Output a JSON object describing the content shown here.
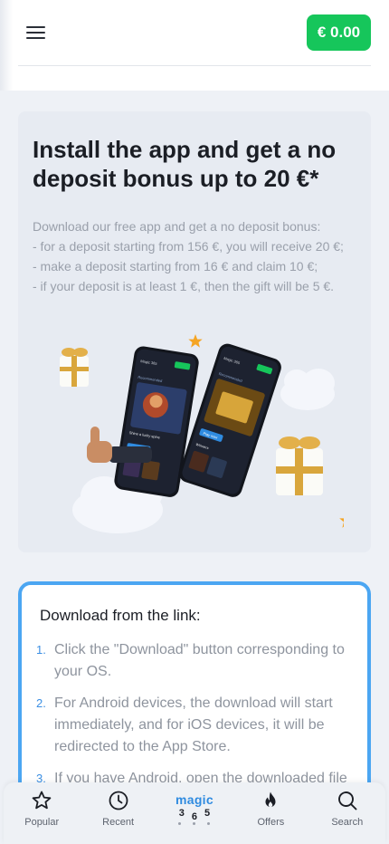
{
  "header": {
    "balance": "€ 0.00"
  },
  "promo": {
    "title": "Install the app and get a no deposit bonus up to 20 €*",
    "description": [
      "Download our free app and get a no deposit bonus:",
      "- for a deposit starting from 156 €, you will receive 20 €;",
      "- make a deposit starting from 16 € and claim 10 €;",
      "- if your deposit is at least 1 €, then the gift will be 5 €."
    ],
    "phone_left": {
      "brand": "Magic 365",
      "section": "Recommended",
      "card_title": "Shine a lucky spine",
      "button": "Play now"
    },
    "phone_right": {
      "brand": "Magic 365",
      "section": "Recommended",
      "button": "Play now",
      "section2": "Winners"
    }
  },
  "instructions": {
    "title": "Download from the link:",
    "steps": [
      {
        "num": "1.",
        "text": "Click the \"Download\" button corresponding to your OS."
      },
      {
        "num": "2.",
        "text": "For Android devices, the download will start immediately, and for iOS devices, it will be redirected to the App Store."
      },
      {
        "num": "3.",
        "text": "If you have Android, open the downloaded file and follow the instructions."
      }
    ]
  },
  "bottom_nav": {
    "items": [
      {
        "label": "Popular",
        "icon": "star-icon"
      },
      {
        "label": "Recent",
        "icon": "clock-icon"
      },
      {
        "label": "",
        "icon": "magic365-logo"
      },
      {
        "label": "Offers",
        "icon": "fire-icon"
      },
      {
        "label": "Search",
        "icon": "search-icon"
      }
    ],
    "logo": {
      "word": "magic",
      "digits": [
        "3",
        "6",
        "5"
      ]
    }
  },
  "colors": {
    "accent_green": "#16c65b",
    "accent_blue": "#4ba6f2",
    "card_bg": "#e7ebf2",
    "text_muted": "#9aa0ab"
  }
}
